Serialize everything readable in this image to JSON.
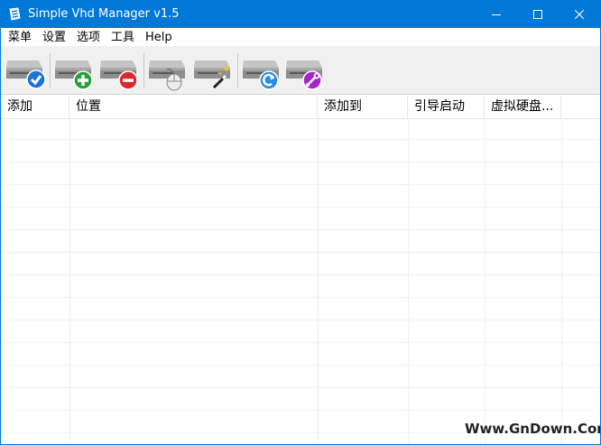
{
  "window": {
    "title": "Simple Vhd Manager v1.5",
    "accent_color": "#0078d7"
  },
  "menu": [
    "菜单",
    "设置",
    "选项",
    "工具",
    "Help"
  ],
  "toolbar": [
    {
      "icon": "drive-check-icon",
      "badge_color": "#1e74d6"
    },
    {
      "icon": "drive-add-icon",
      "badge_color": "#22a33a"
    },
    {
      "icon": "drive-remove-icon",
      "badge_color": "#e0262d"
    },
    {
      "icon": "drive-mouse-icon",
      "badge_color": "#dcdcdc"
    },
    {
      "icon": "drive-wand-icon",
      "badge_color": "#f0c020"
    },
    {
      "icon": "drive-refresh-icon",
      "badge_color": "#2a8de0"
    },
    {
      "icon": "drive-tools-icon",
      "badge_color": "#a624c8"
    }
  ],
  "columns": [
    "添加",
    "位置",
    "添加到",
    "引导启动",
    "虚拟硬盘..."
  ],
  "watermark": "Www.GnDown.Com"
}
